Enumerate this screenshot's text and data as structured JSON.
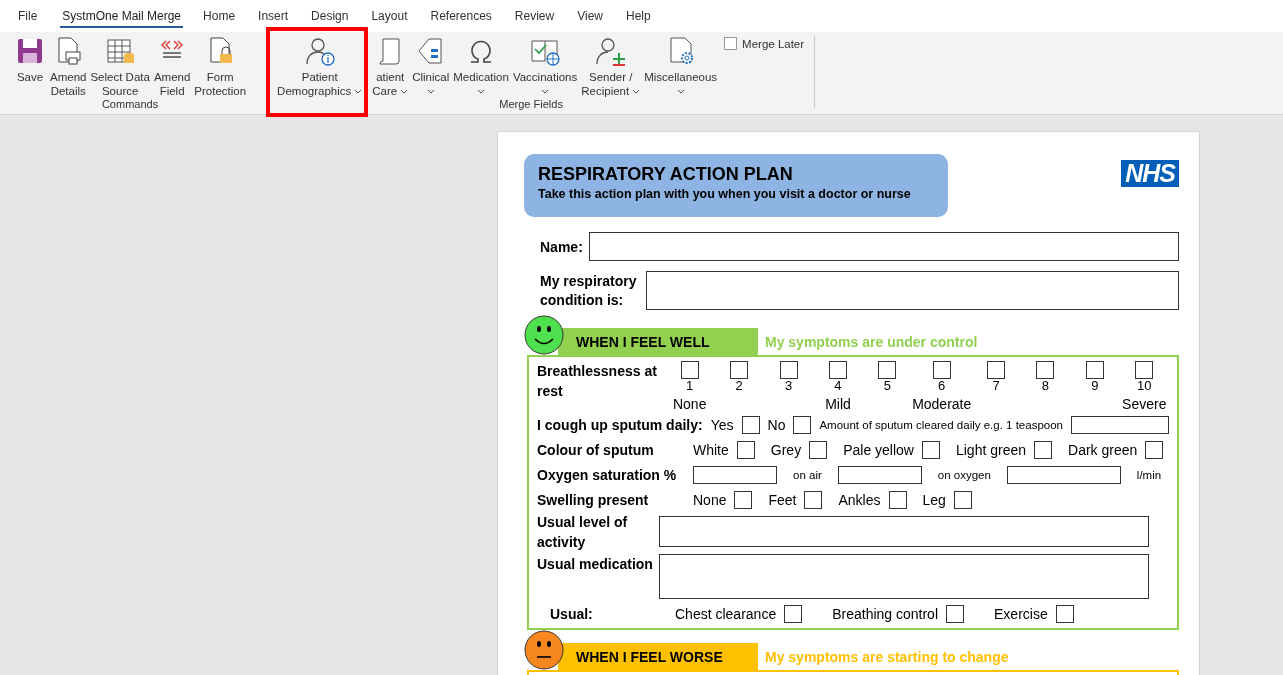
{
  "tabs": [
    {
      "label": "File",
      "selected": false
    },
    {
      "label": "SystmOne Mail Merge",
      "selected": true
    },
    {
      "label": "Home",
      "selected": false
    },
    {
      "label": "Insert",
      "selected": false
    },
    {
      "label": "Design",
      "selected": false
    },
    {
      "label": "Layout",
      "selected": false
    },
    {
      "label": "References",
      "selected": false
    },
    {
      "label": "Review",
      "selected": false
    },
    {
      "label": "View",
      "selected": false
    },
    {
      "label": "Help",
      "selected": false
    }
  ],
  "ribbon": {
    "groups": [
      {
        "label": "Commands",
        "buttons": [
          {
            "lines": [
              "Save"
            ],
            "dropdown": false,
            "highlighted": false
          },
          {
            "lines": [
              "Amend",
              "Details"
            ],
            "dropdown": false,
            "highlighted": false
          },
          {
            "lines": [
              "Select Data",
              "Source"
            ],
            "dropdown": false,
            "highlighted": false
          },
          {
            "lines": [
              "Amend",
              "Field"
            ],
            "dropdown": false,
            "highlighted": false
          },
          {
            "lines": [
              "Form",
              "Protection"
            ],
            "dropdown": false,
            "highlighted": false
          }
        ]
      },
      {
        "label": "Merge Fields",
        "buttons": [
          {
            "lines": [
              "Patient",
              "Demographics"
            ],
            "dropdown": true,
            "highlighted": true
          },
          {
            "lines": [
              "atient",
              "Care"
            ],
            "dropdown": true,
            "highlighted": false
          },
          {
            "lines": [
              "Clinical"
            ],
            "dropdown": true,
            "highlighted": false
          },
          {
            "lines": [
              "Medication"
            ],
            "dropdown": true,
            "highlighted": false
          },
          {
            "lines": [
              "Vaccinations"
            ],
            "dropdown": true,
            "highlighted": false
          },
          {
            "lines": [
              "Sender /",
              "Recipient"
            ],
            "dropdown": true,
            "highlighted": false
          },
          {
            "lines": [
              "Miscellaneous"
            ],
            "dropdown": true,
            "highlighted": false
          }
        ],
        "checkbox": {
          "label": "Merge Later",
          "checked": false
        }
      }
    ]
  },
  "document": {
    "title": "RESPIRATORY ACTION PLAN",
    "subtitle": "Take this action plan with you when you visit a doctor or nurse",
    "logo": "NHS",
    "fields": [
      {
        "label": "Name:"
      },
      {
        "label": "My respiratory condition is:"
      }
    ],
    "sections": [
      {
        "kind": "well",
        "heading": "WHEN I FEEL WELL",
        "caption": "My symptoms are under control",
        "rows": [
          {
            "kind": "scale",
            "label": "Breathlessness at rest",
            "scale": [
              {
                "number": "1",
                "label": "None",
                "checked": false
              },
              {
                "number": "2",
                "checked": false
              },
              {
                "number": "3",
                "checked": false
              },
              {
                "number": "4",
                "label": "Mild",
                "checked": false
              },
              {
                "number": "5",
                "checked": false
              },
              {
                "number": "6",
                "label": "Moderate",
                "checked": false
              },
              {
                "number": "7",
                "checked": false
              },
              {
                "number": "8",
                "checked": false
              },
              {
                "number": "9",
                "checked": false
              },
              {
                "number": "10",
                "label": "Severe",
                "checked": false
              }
            ]
          },
          {
            "kind": "inline",
            "label": "I cough up sputum daily:",
            "items": [
              {
                "kind": "option",
                "label": "Yes",
                "checked": false
              },
              {
                "kind": "option",
                "label": "No",
                "checked": false
              },
              {
                "kind": "note",
                "text": "Amount of sputum cleared daily e.g. 1 teaspoon"
              },
              {
                "kind": "field"
              }
            ]
          },
          {
            "kind": "inline",
            "label": "Colour of sputum",
            "items": [
              {
                "kind": "option",
                "label": "White",
                "checked": false
              },
              {
                "kind": "option",
                "label": "Grey",
                "checked": false
              },
              {
                "kind": "option",
                "label": "Pale yellow",
                "checked": false
              },
              {
                "kind": "option",
                "label": "Light green",
                "checked": false
              },
              {
                "kind": "option",
                "label": "Dark green",
                "checked": false
              }
            ]
          },
          {
            "kind": "inline",
            "label": "Oxygen saturation %",
            "items": [
              {
                "kind": "field"
              },
              {
                "kind": "unit",
                "text": "on air"
              },
              {
                "kind": "field"
              },
              {
                "kind": "unit",
                "text": "on oxygen"
              },
              {
                "kind": "field"
              },
              {
                "kind": "unit",
                "text": "l/min"
              }
            ]
          },
          {
            "kind": "inline",
            "label": "Swelling present",
            "items": [
              {
                "kind": "option",
                "label": "None",
                "checked": false
              },
              {
                "kind": "option",
                "label": "Feet",
                "checked": false
              },
              {
                "kind": "option",
                "label": "Ankles",
                "checked": false
              },
              {
                "kind": "option",
                "label": "Leg",
                "checked": false
              }
            ]
          },
          {
            "kind": "box",
            "label": "Usual level of activity"
          },
          {
            "kind": "box",
            "label": "Usual medication"
          },
          {
            "kind": "usual",
            "label": "Usual:",
            "items": [
              {
                "kind": "option",
                "label": "Chest clearance",
                "checked": false
              },
              {
                "kind": "option",
                "label": "Breathing control",
                "checked": false
              },
              {
                "kind": "option",
                "label": "Exercise",
                "checked": false
              }
            ]
          }
        ]
      },
      {
        "kind": "worse",
        "heading": "WHEN I FEEL WORSE",
        "caption": "My symptoms are starting to change"
      }
    ]
  }
}
